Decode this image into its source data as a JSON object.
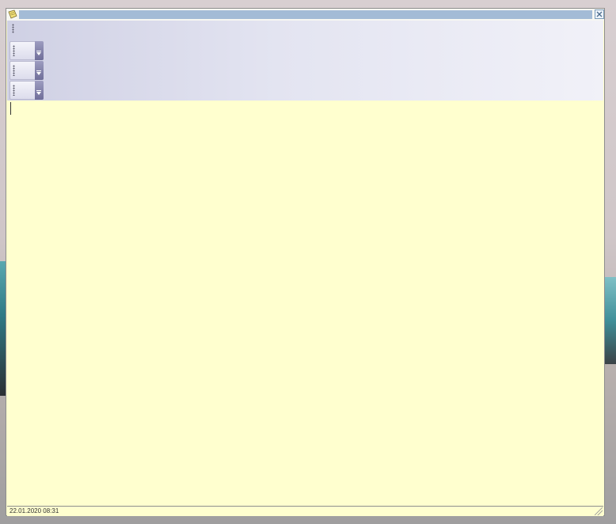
{
  "window": {
    "title": "",
    "icons": {
      "app": "sticky-note-icon",
      "close": "close-icon"
    }
  },
  "toolbars": {
    "count": 3,
    "grip_icon": "grip-handle-icon",
    "dropdown_icon": "toolbar-options-dropdown-icon"
  },
  "editor": {
    "content": ""
  },
  "statusbar": {
    "timestamp": "22.01.2020 08:31"
  },
  "colors": {
    "note_background": "#ffffcf",
    "caption_bar": "#a3bbd6",
    "toolbar_gradient_start": "#cfd0e4",
    "toolbar_gradient_end": "#f1f1f8"
  }
}
